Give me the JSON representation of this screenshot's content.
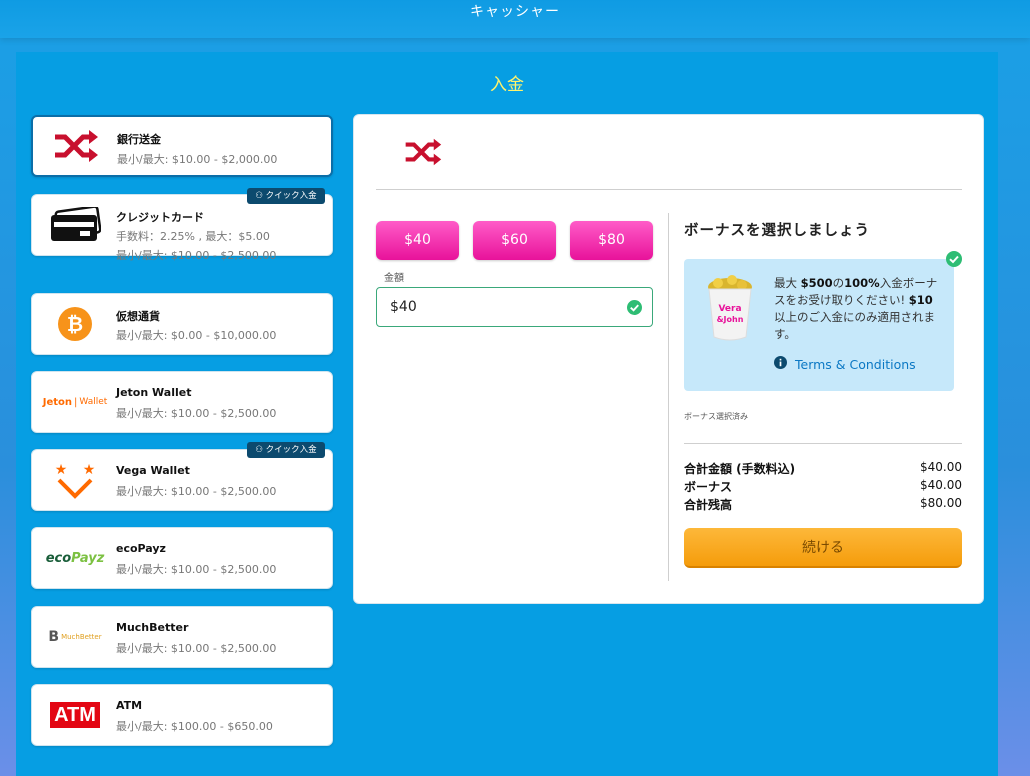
{
  "header": {
    "title": "キャッシャー"
  },
  "panel": {
    "title": "入金"
  },
  "methods": [
    {
      "name": "銀行送金",
      "limit": "最小/最大: $10.00 - $2,000.00",
      "logo": "shuffle-icon"
    },
    {
      "name": "クレジットカード",
      "fee": "手数料：2.25% , 最大：$5.00",
      "limit": "最小/最大: $10.00 - $2,500.00",
      "logo": "credit-card-icon",
      "badge": "クイック入金"
    },
    {
      "name": "仮想通貨",
      "limit": "最小/最大: $0.00 - $10,000.00",
      "logo": "bitcoin-icon"
    },
    {
      "name": "Jeton Wallet",
      "limit": "最小/最大: $10.00 - $2,500.00",
      "logo": "jeton-wallet-logo",
      "logo_text_a": "Jeton",
      "logo_text_b": "Wallet"
    },
    {
      "name": "Vega Wallet",
      "limit": "最小/最大: $10.00 - $2,500.00",
      "logo": "vega-wallet-logo",
      "badge": "クイック入金"
    },
    {
      "name": "ecoPayz",
      "limit": "最小/最大: $10.00 - $2,500.00",
      "logo": "ecopayz-logo",
      "logo_text_a": "eco",
      "logo_text_b": "Payz"
    },
    {
      "name": "MuchBetter",
      "limit": "最小/最大: $10.00 - $2,500.00",
      "logo": "muchbetter-logo",
      "logo_text": "MuchBetter"
    },
    {
      "name": "ATM",
      "limit": "最小/最大: $100.00 - $650.00",
      "logo": "atm-logo",
      "logo_text": "ATM"
    }
  ],
  "deposit": {
    "amount_buttons": [
      "$40",
      "$60",
      "$80"
    ],
    "amount_label": "金額",
    "amount_value": "$40"
  },
  "bonus": {
    "title": "ボーナスを選択しましょう",
    "text_1": "最大 ",
    "text_bold_1": "$500",
    "text_2": "の",
    "text_bold_2": "100%",
    "text_3": "入金ボーナスをお受け取りください! ",
    "text_bold_3": "$10",
    "text_4": "以上のご入金にのみ適用されます。",
    "terms": "Terms & Conditions",
    "selected_note": "ボーナス選択済み",
    "image_text": "Vera&John"
  },
  "summary": {
    "rows": [
      {
        "label": "合計金額 (手数料込)",
        "value": "$40.00"
      },
      {
        "label": "ボーナス",
        "value": "$40.00"
      },
      {
        "label": "合計残高",
        "value": "$80.00"
      }
    ],
    "continue_label": "続ける"
  },
  "colors": {
    "accent": "#069ee3",
    "pink": "#e8129a",
    "orange": "#f59c0b",
    "brand_red": "#c8102e"
  }
}
